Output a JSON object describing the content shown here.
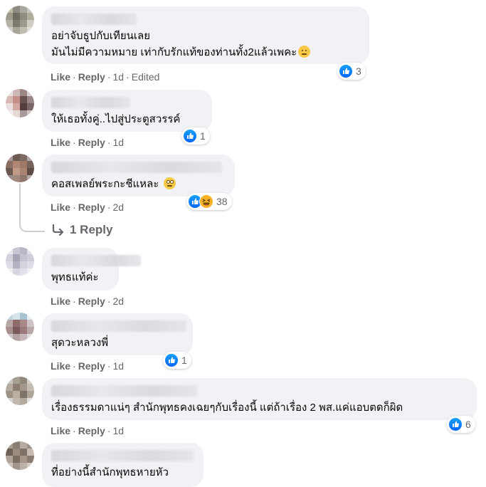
{
  "actions": {
    "like": "Like",
    "reply": "Reply",
    "edited": "Edited"
  },
  "comments": [
    {
      "text": "อย่าจับธูปกับเทียนเลย\nมันไม่มีความหมาย เท่ากับรักแท้ของท่านทั้ง2แล้วเพคะ",
      "time": "1d",
      "reactions": "3",
      "emoji": "frown-emoji",
      "edited": true
    },
    {
      "text": "ให้เธอทั้งคู่..ไปสู่ประตูสวรรค์",
      "time": "1d",
      "reactions": "1"
    },
    {
      "text": "คอสเพลย์พระกะชีแหละ",
      "time": "2d",
      "reactions": "38",
      "emoji": "eye-roll-emoji"
    },
    {
      "text": "พุทธแท้ค่ะ",
      "time": "2d"
    },
    {
      "text": "สุดวะหลวงพี่",
      "time": "1d",
      "reactions": "1"
    },
    {
      "text": "เรื่องธรรมดาแน่ๆ สำนักพุทธคงเฉยๆกับเรื่องนี้ แต่ถ้าเรื่อง 2 พส.แค่แอบตดก็ผิด",
      "time": "1d",
      "reactions": "6"
    },
    {
      "text": "ที่อย่างนี้สำนักพุทธหายหัว"
    }
  ],
  "view_replies": {
    "label": "1 Reply"
  },
  "colors": {
    "bubble": "#f0f2f5",
    "meta": "#65676b",
    "like_blue": "#0866ff",
    "text": "#050505"
  }
}
